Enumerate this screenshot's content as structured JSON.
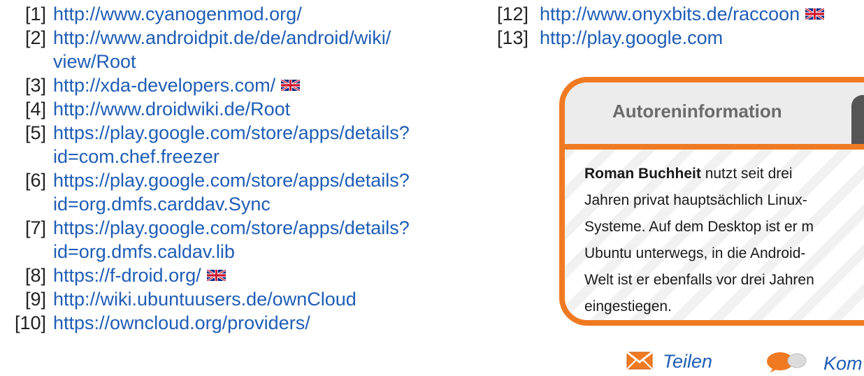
{
  "references_left": [
    {
      "num": "[1]",
      "lines": [
        "http://www.cyanogenmod.org/"
      ],
      "flag": false
    },
    {
      "num": "[2]",
      "lines": [
        "http://www.androidpit.de/de/android/wiki/",
        "view/Root"
      ],
      "flag": false
    },
    {
      "num": "[3]",
      "lines": [
        "http://xda-developers.com/"
      ],
      "flag": true
    },
    {
      "num": "[4]",
      "lines": [
        "http://www.droidwiki.de/Root"
      ],
      "flag": false
    },
    {
      "num": "[5]",
      "lines": [
        "https://play.google.com/store/apps/details?",
        "id=com.chef.freezer"
      ],
      "flag": false
    },
    {
      "num": "[6]",
      "lines": [
        "https://play.google.com/store/apps/details?",
        "id=org.dmfs.carddav.Sync"
      ],
      "flag": false
    },
    {
      "num": "[7]",
      "lines": [
        "https://play.google.com/store/apps/details?",
        "id=org.dmfs.caldav.lib"
      ],
      "flag": false
    },
    {
      "num": "[8]",
      "lines": [
        "https://f-droid.org/"
      ],
      "flag": true
    },
    {
      "num": "[9]",
      "lines": [
        "http://wiki.ubuntuusers.de/ownCloud"
      ],
      "flag": false
    },
    {
      "num": "[10]",
      "lines": [
        "https://owncloud.org/providers/"
      ],
      "flag": false
    }
  ],
  "references_right": [
    {
      "num": "[12]",
      "lines": [
        "http://www.onyxbits.de/raccoon"
      ],
      "flag": true
    },
    {
      "num": "[13]",
      "lines": [
        "http://play.google.com"
      ],
      "flag": false
    }
  ],
  "author_box": {
    "title": "Autoreninformation",
    "name": "Roman Buchheit",
    "text": "nutzt seit drei Jahren privat hauptsächlich Linux-Systeme. Auf dem Desktop ist er m Ubuntu unterwegs, in die Android-Welt ist er ebenfalls vor drei Jahren eingestiegen.",
    "lines": [
      "nutzt seit drei",
      "Jahren privat hauptsächlich Linux-",
      "Systeme. Auf dem Desktop ist er m",
      "Ubuntu unterwegs, in die Android-",
      "Welt ist er ebenfalls vor drei Jahren",
      "eingestiegen."
    ]
  },
  "actions": {
    "share": "Teilen",
    "comment": "Kom"
  },
  "colors": {
    "link": "#1f5db5",
    "accent": "#f07a22"
  },
  "icons": {
    "flag": "uk-flag-icon",
    "share": "envelope-icon",
    "comment": "speech-bubbles-icon"
  }
}
